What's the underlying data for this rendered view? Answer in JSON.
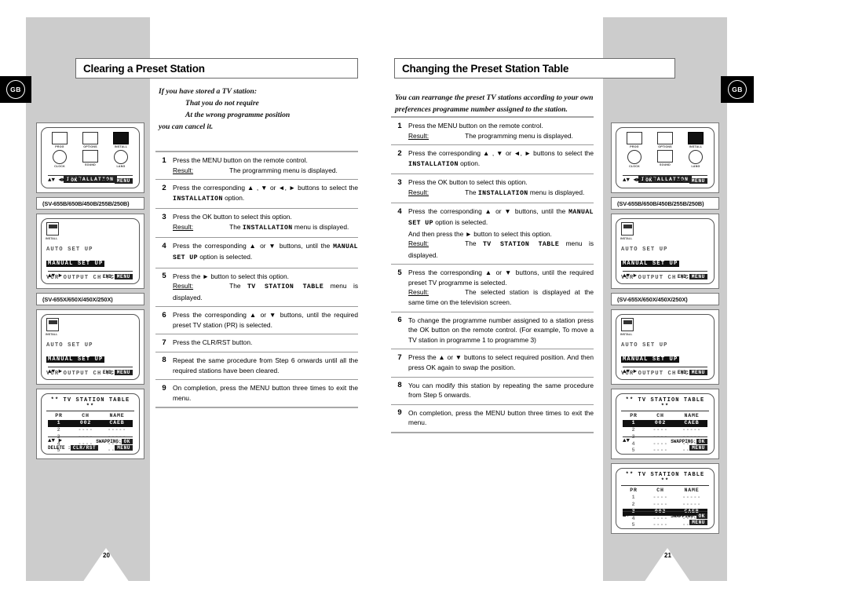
{
  "document": {
    "type": "vcr-user-manual-spread",
    "left_page_number": "20",
    "right_page_number": "21",
    "region_badge": "GB"
  },
  "left": {
    "section_title": "Clearing a Preset Station",
    "intro": {
      "line1": "If you have stored a TV station:",
      "line2": "That you do not require",
      "line3": "At the wrong programme position",
      "line4": "you can cancel it."
    },
    "steps": [
      {
        "num": "1",
        "text": "Press the MENU button on the remote control.",
        "result_label": "Result:",
        "result": "The programming menu is displayed."
      },
      {
        "num": "2",
        "text_pre": "Press the corresponding ▲ , ▼ or ◄, ► buttons to select the",
        "mono": "INSTALLATION",
        "text_post": " option."
      },
      {
        "num": "3",
        "text": "Press the OK button to select this option.",
        "result_label": "Result:",
        "result_mono": "INSTALLATION",
        "result_pre": "The ",
        "result_post": " menu is displayed."
      },
      {
        "num": "4",
        "text_pre": "Press the corresponding ▲ or ▼ buttons, until the ",
        "mono": "MANUAL SET UP",
        "text_post": " option is selected."
      },
      {
        "num": "5",
        "text": "Press the ► button to select this option.",
        "result_label": "Result:",
        "result_pre": "The ",
        "result_mono": "TV STATION TABLE",
        "result_post": " menu is displayed."
      },
      {
        "num": "6",
        "text": "Press the corresponding ▲ or ▼ buttons, until the required preset TV station (PR) is selected."
      },
      {
        "num": "7",
        "text": "Press the CLR/RST button."
      },
      {
        "num": "8",
        "text": "Repeat the same procedure from Step 6 onwards until all the required stations have been cleared."
      },
      {
        "num": "9",
        "text": "On completion, press the MENU button three times to exit the menu."
      }
    ],
    "screens": [
      {
        "kind": "icon-menu",
        "icons": [
          {
            "name": "prog-icon",
            "cap": "PROG"
          },
          {
            "name": "options-icon",
            "cap": "OPTIONS"
          },
          {
            "name": "install-icon",
            "cap": "INSTALL",
            "selected": true
          },
          {
            "name": "clock-icon",
            "cap": "CLOCK"
          },
          {
            "name": "sound-icon",
            "cap": "SOUND"
          },
          {
            "name": "lang-icon",
            "cap": "LANG"
          }
        ],
        "caption": "INSTALLATION",
        "footer_left": "▲▼  ◄►",
        "footer_key1": "OK",
        "footer_right": "END :",
        "footer_key2": "MENU"
      },
      {
        "kind": "model-label",
        "label": "(SV-655B/650B/450B/255B/250B)"
      },
      {
        "kind": "installation-menu",
        "icon_cap": "INSTALL",
        "lines": [
          {
            "text": "AUTO SET UP",
            "highlight": false
          },
          {
            "text": "MANUAL SET UP",
            "highlight": true
          },
          {
            "text": "VCR OUTPUT CH :CH38",
            "highlight": false
          }
        ],
        "footer_left": "▲▼   ►",
        "footer_right": "END:",
        "footer_key": "MENU"
      },
      {
        "kind": "model-label",
        "label": "(SV-655X/650X/450X/250X)"
      },
      {
        "kind": "installation-menu",
        "icon_cap": "INSTALL",
        "lines": [
          {
            "text": "AUTO SET UP",
            "highlight": false
          },
          {
            "text": "MANUAL SET UP",
            "highlight": true
          },
          {
            "text": "VCR OUTPUT CH :CH36",
            "highlight": false
          }
        ],
        "footer_left": "▲▼   ►",
        "footer_right": "END:",
        "footer_key": "MENU"
      },
      {
        "kind": "station-table",
        "title": "** TV STATION TABLE **",
        "headers": [
          "PR",
          "CH",
          "NAME"
        ],
        "rows": [
          {
            "pr": "1",
            "ch": "002",
            "name": "CAEB",
            "highlight": true
          },
          {
            "pr": "2",
            "ch": "----",
            "name": "-----",
            "highlight": false
          },
          {
            "pr": "3",
            "ch": "----",
            "name": "-----",
            "highlight": false
          },
          {
            "pr": "4",
            "ch": "----",
            "name": "-----",
            "highlight": false
          },
          {
            "pr": "5",
            "ch": "----",
            "name": "-----",
            "highlight": false
          }
        ],
        "foot_left": "▲▼   ►",
        "foot_swap": "SWAPPING:",
        "foot_swap_key": "OK",
        "foot_delete": "DELETE :",
        "foot_delete_key": "CLR/RST",
        "foot_menu_key": "MENU"
      }
    ]
  },
  "right": {
    "section_title": "Changing the Preset Station Table",
    "intro": {
      "line1": "You can rearrange the preset TV stations according to your own",
      "line2": "preferences programme number assigned to the station."
    },
    "steps": [
      {
        "num": "1",
        "text": "Press the MENU button on the remote control.",
        "result_label": "Result:",
        "result": "The programming menu is displayed."
      },
      {
        "num": "2",
        "text_pre": "Press the corresponding ▲ , ▼ or ◄, ► buttons to select the",
        "mono": "INSTALLATION",
        "text_post": " option."
      },
      {
        "num": "3",
        "text": "Press the OK button to select this option.",
        "result_label": "Result:",
        "result_pre": "The ",
        "result_mono": "INSTALLATION",
        "result_post": " menu is displayed."
      },
      {
        "num": "4",
        "text_pre": "Press the corresponding ▲ or ▼ buttons, until the ",
        "mono": "MANUAL SET UP",
        "text_post": " option is selected.",
        "extra": "And then press the ► button to select this option.",
        "result_label": "Result:",
        "result_pre": "The ",
        "result_mono": "TV STATION TABLE",
        "result_post": " menu is displayed."
      },
      {
        "num": "5",
        "text": "Press the corresponding ▲ or ▼ buttons, until the required preset TV programme is selected.",
        "result_label": "Result:",
        "result": "The selected station is displayed at the same time on the television screen."
      },
      {
        "num": "6",
        "text": "To change the programme number assigned to a station press the OK button on the remote control. (For example, To move a TV station in programme 1 to programme 3)"
      },
      {
        "num": "7",
        "text": "Press the ▲ or ▼ buttons to select required position. And then press OK again to swap the position."
      },
      {
        "num": "8",
        "text": "You can modify this station by repeating the same procedure from Step 5 onwards."
      },
      {
        "num": "9",
        "text": "On completion, press the MENU button three times to exit the menu."
      }
    ],
    "screens": [
      {
        "kind": "icon-menu",
        "icons": [
          {
            "name": "prog-icon",
            "cap": "PROG"
          },
          {
            "name": "options-icon",
            "cap": "OPTIONS"
          },
          {
            "name": "install-icon",
            "cap": "INSTALL",
            "selected": true
          },
          {
            "name": "clock-icon",
            "cap": "CLOCK"
          },
          {
            "name": "sound-icon",
            "cap": "SOUND"
          },
          {
            "name": "lang-icon",
            "cap": "LANG"
          }
        ],
        "caption": "INSTALLATION",
        "footer_left": "▲▼  ◄►",
        "footer_key1": "OK",
        "footer_right": "END :",
        "footer_key2": "MENU"
      },
      {
        "kind": "model-label",
        "label": "(SV-655B/650B/450B/255B/250B)"
      },
      {
        "kind": "installation-menu",
        "icon_cap": "INSTALL",
        "lines": [
          {
            "text": "AUTO SET UP",
            "highlight": false
          },
          {
            "text": "MANUAL SET UP",
            "highlight": true
          },
          {
            "text": "VCR OUTPUT CH :CH38",
            "highlight": false
          }
        ],
        "footer_left": "▲▼   ►",
        "footer_right": "END:",
        "footer_key": "MENU"
      },
      {
        "kind": "model-label",
        "label": "(SV-655X/650X/450X/250X)"
      },
      {
        "kind": "installation-menu",
        "icon_cap": "INSTALL",
        "lines": [
          {
            "text": "AUTO SET UP",
            "highlight": false
          },
          {
            "text": "MANUAL SET UP",
            "highlight": true
          },
          {
            "text": "VCR OUTPUT CH :CH36",
            "highlight": false
          }
        ],
        "footer_left": "▲▼   ►",
        "footer_right": "END:",
        "footer_key": "MENU"
      },
      {
        "kind": "station-table",
        "title": "** TV STATION TABLE **",
        "headers": [
          "PR",
          "CH",
          "NAME"
        ],
        "rows": [
          {
            "pr": "1",
            "ch": "002",
            "name": "CAEB",
            "highlight": true
          },
          {
            "pr": "2",
            "ch": "----",
            "name": "-----",
            "highlight": false
          },
          {
            "pr": "3",
            "ch": "----",
            "name": "-----",
            "highlight": false
          },
          {
            "pr": "4",
            "ch": "----",
            "name": "-----",
            "highlight": false
          },
          {
            "pr": "5",
            "ch": "----",
            "name": "-----",
            "highlight": false
          }
        ],
        "foot_left": "▲▼",
        "foot_swap": "SWAPPING:",
        "foot_swap_key": "OK",
        "foot_menu_key": "MENU"
      },
      {
        "kind": "station-table",
        "title": "** TV STATION TABLE **",
        "headers": [
          "PR",
          "CH",
          "NAME"
        ],
        "rows": [
          {
            "pr": "1",
            "ch": "----",
            "name": "-----",
            "highlight": false
          },
          {
            "pr": "2",
            "ch": "----",
            "name": "-----",
            "highlight": false
          },
          {
            "pr": "3",
            "ch": "002",
            "name": "CAEB",
            "highlight": true
          },
          {
            "pr": "4",
            "ch": "----",
            "name": "-----",
            "highlight": false
          },
          {
            "pr": "5",
            "ch": "----",
            "name": "-----",
            "highlight": false
          }
        ],
        "foot_left": "▲▼",
        "foot_swap": "SWAPPING:",
        "foot_swap_key": "OK",
        "foot_menu_key": "MENU"
      }
    ]
  }
}
